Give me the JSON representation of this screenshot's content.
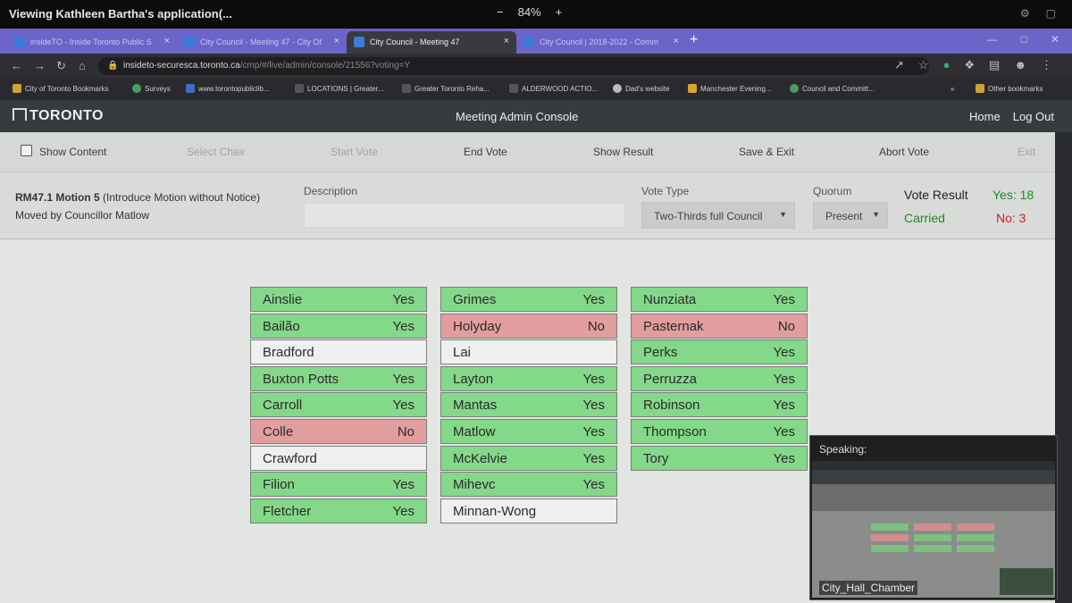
{
  "viewer": {
    "title": "Viewing Kathleen Bartha's application(...",
    "zoom": "84%",
    "zoom_minus": "−",
    "zoom_plus": "+"
  },
  "browser": {
    "tabs": [
      {
        "label": "insideTO - Inside Toronto Public S",
        "close": "×"
      },
      {
        "label": "City Council - Meeting 47 - City Of",
        "close": "×"
      },
      {
        "label": "City Council - Meeting 47",
        "close": "×"
      },
      {
        "label": "City Council | 2018-2022 - Comm",
        "close": "×"
      }
    ],
    "new_tab": "+",
    "url_host": "insideto-securesca.toronto.ca",
    "url_path": "/cmp/#/live/admin/console/21556?voting=Y",
    "bookmarks": [
      "City of Toronto Bookmarks",
      "Surveys",
      "www.torontopubliclib...",
      "LOCATIONS | Greater...",
      "Greater Toronto Reha...",
      "ALDERWOOD ACTIO...",
      "Dad's website",
      "Manchester Evening...",
      "Council and Committ...",
      "»",
      "Other bookmarks"
    ]
  },
  "app": {
    "logo": "TORONTO",
    "title": "Meeting Admin Console",
    "nav": [
      "Home",
      "Log Out"
    ]
  },
  "toolbar": {
    "show_content": "Show Content",
    "select_chair": "Select Chair",
    "start_vote": "Start Vote",
    "end_vote": "End Vote",
    "show_result": "Show Result",
    "save_exit": "Save & Exit",
    "abort_vote": "Abort Vote",
    "exit": "Exit"
  },
  "motion": {
    "item": "RM47.1 Motion 5",
    "detail": " (Introduce Motion without Notice)",
    "moved_by": "Moved by Councillor Matlow",
    "description_label": "Description",
    "vote_type_label": "Vote Type",
    "vote_type": "Two-Thirds full Council",
    "quorum_label": "Quorum",
    "quorum": "Present",
    "result_label": "Vote Result",
    "yes": "Yes: 18",
    "status": "Carried",
    "no": "No: 3"
  },
  "councillors": [
    [
      {
        "name": "Ainslie",
        "vote": "Yes"
      },
      {
        "name": "Bailão",
        "vote": "Yes"
      },
      {
        "name": "Bradford",
        "vote": ""
      },
      {
        "name": "Buxton Potts",
        "vote": "Yes"
      },
      {
        "name": "Carroll",
        "vote": "Yes"
      },
      {
        "name": "Colle",
        "vote": "No"
      },
      {
        "name": "Crawford",
        "vote": ""
      },
      {
        "name": "Filion",
        "vote": "Yes"
      },
      {
        "name": "Fletcher",
        "vote": "Yes"
      }
    ],
    [
      {
        "name": "Grimes",
        "vote": "Yes"
      },
      {
        "name": "Holyday",
        "vote": "No"
      },
      {
        "name": "Lai",
        "vote": ""
      },
      {
        "name": "Layton",
        "vote": "Yes"
      },
      {
        "name": "Mantas",
        "vote": "Yes"
      },
      {
        "name": "Matlow",
        "vote": "Yes"
      },
      {
        "name": "McKelvie",
        "vote": "Yes"
      },
      {
        "name": "Mihevc",
        "vote": "Yes"
      },
      {
        "name": "Minnan-Wong",
        "vote": ""
      }
    ],
    [
      {
        "name": "Nunziata",
        "vote": "Yes"
      },
      {
        "name": "Pasternak",
        "vote": "No"
      },
      {
        "name": "Perks",
        "vote": "Yes"
      },
      {
        "name": "Perruzza",
        "vote": "Yes"
      },
      {
        "name": "Robinson",
        "vote": "Yes"
      },
      {
        "name": "Thompson",
        "vote": "Yes"
      },
      {
        "name": "Tory",
        "vote": "Yes"
      }
    ]
  ],
  "speaker": {
    "label": "Speaking:",
    "camera": "City_Hall_Chamber"
  },
  "colors": {
    "yes": "#84d88a",
    "no": "#e29e9e",
    "none": "#eef0ef",
    "tab_strip": "#6b64c9",
    "header": "#363b40"
  }
}
